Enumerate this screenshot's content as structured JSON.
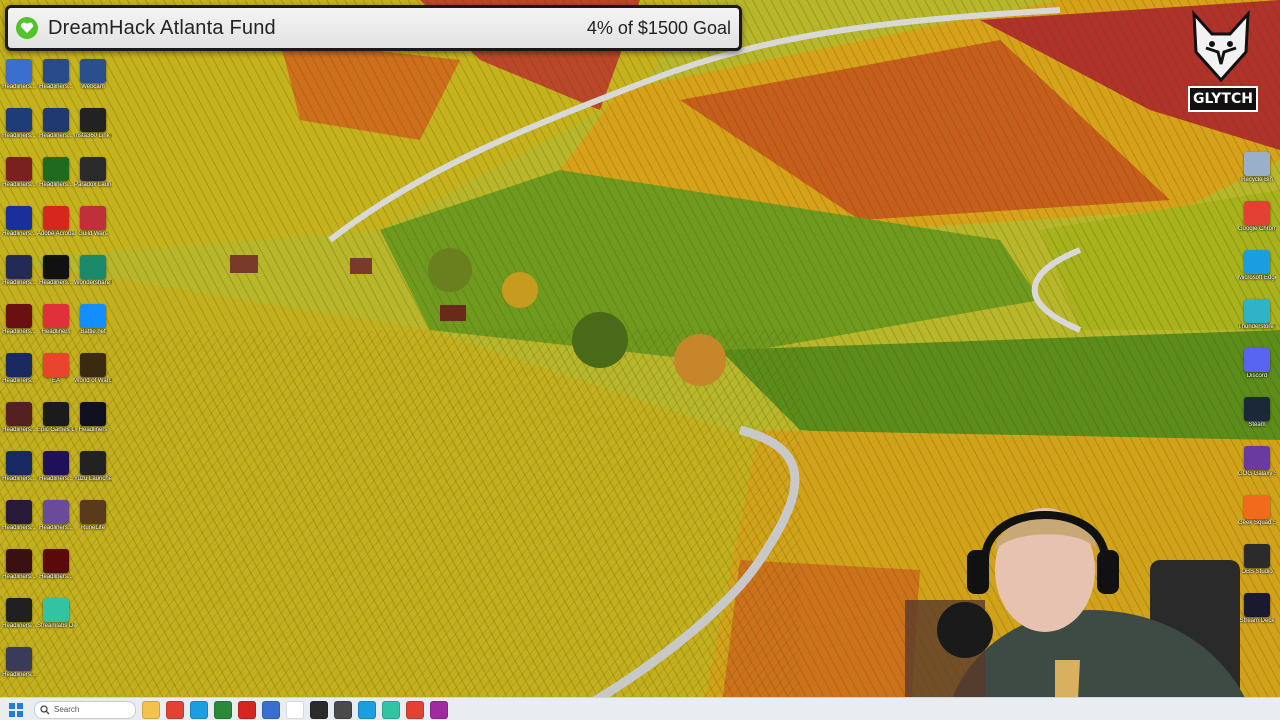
{
  "fund_banner": {
    "title": "DreamHack Atlanta Fund",
    "goal_text": "4% of $1500 Goal",
    "progress_fraction": 0.04
  },
  "streamer_logo": {
    "text": "GLYTCH"
  },
  "desktop": {
    "left_column_1": [
      {
        "label": "Headliners...",
        "icon": "app-icon",
        "color": "#3a6fcf"
      },
      {
        "label": "Headliners...",
        "icon": "app-icon",
        "color": "#1f3c7a"
      },
      {
        "label": "Headliners...",
        "icon": "app-icon",
        "color": "#7a2020"
      },
      {
        "label": "Headliners...",
        "icon": "app-icon",
        "color": "#1b2f9c"
      },
      {
        "label": "Headliners...",
        "icon": "app-icon",
        "color": "#222a55"
      },
      {
        "label": "Headliners...",
        "icon": "app-icon",
        "color": "#6a1010"
      },
      {
        "label": "Headliners...",
        "icon": "app-icon",
        "color": "#1a2a60"
      },
      {
        "label": "Headliners...",
        "icon": "app-icon",
        "color": "#552020"
      },
      {
        "label": "Headliners...",
        "icon": "app-icon",
        "color": "#182860"
      },
      {
        "label": "Headliners...",
        "icon": "app-icon",
        "color": "#2a1a3a"
      },
      {
        "label": "Headliners...",
        "icon": "app-icon",
        "color": "#3a1010"
      },
      {
        "label": "Headliners...",
        "icon": "app-icon",
        "color": "#202020"
      },
      {
        "label": "Headliners...",
        "icon": "app-icon",
        "color": "#3a3a5a"
      }
    ],
    "left_column_2": [
      {
        "label": "Headliners...",
        "icon": "app-icon",
        "color": "#284b8c"
      },
      {
        "label": "Headliners...",
        "icon": "app-icon",
        "color": "#203a70"
      },
      {
        "label": "Headliners...",
        "icon": "app-icon",
        "color": "#1e6a1e"
      },
      {
        "label": "Adobe Acrobat",
        "icon": "acrobat-icon",
        "color": "#d7261e"
      },
      {
        "label": "Headliners...",
        "icon": "app-icon",
        "color": "#111111"
      },
      {
        "label": "Headliners",
        "icon": "app-icon",
        "color": "#e0303a"
      },
      {
        "label": "EA",
        "icon": "ea-icon",
        "color": "#e8452c"
      },
      {
        "label": "Epic Games Launcher",
        "icon": "epic-games-icon",
        "color": "#1b1b1b"
      },
      {
        "label": "Headliners...",
        "icon": "app-icon",
        "color": "#20105a"
      },
      {
        "label": "Headliners...",
        "icon": "app-icon",
        "color": "#6a4a9a"
      },
      {
        "label": "Headliners...",
        "icon": "app-icon",
        "color": "#5a0a0a"
      },
      {
        "label": "Streamlabs Desktop",
        "icon": "streamlabs-icon",
        "color": "#31c3a2"
      }
    ],
    "left_column_3": [
      {
        "label": "Webcam",
        "icon": "webcam-icon",
        "color": "#2b4e8c"
      },
      {
        "label": "Insta360 Link Webcam",
        "icon": "webcam-icon",
        "color": "#222222"
      },
      {
        "label": "Paradox Launcher",
        "icon": "paradox-icon",
        "color": "#2a2a2a"
      },
      {
        "label": "Guild Wars",
        "icon": "app-icon",
        "color": "#c0303a"
      },
      {
        "label": "Wondershare Filmora",
        "icon": "filmora-icon",
        "color": "#1a8a6a"
      },
      {
        "label": "Battle.net",
        "icon": "battlenet-icon",
        "color": "#148eff"
      },
      {
        "label": "World of Warcraft",
        "icon": "wow-icon",
        "color": "#3a2a10"
      },
      {
        "label": "Headliners",
        "icon": "app-icon",
        "color": "#101020"
      },
      {
        "label": "Yuzu Launcher",
        "icon": "app-icon",
        "color": "#222222"
      },
      {
        "label": "RuneLite",
        "icon": "runelite-icon",
        "color": "#5a3a1a"
      }
    ],
    "right_column": [
      {
        "label": "Recycle Bin",
        "icon": "recycle-bin-icon",
        "color": "#9ab0c8"
      },
      {
        "label": "Google Chrome",
        "icon": "chrome-icon",
        "color": "#e34133"
      },
      {
        "label": "Microsoft Edge",
        "icon": "edge-icon",
        "color": "#1b9de2"
      },
      {
        "label": "Thunderstore Mod Manager",
        "icon": "thunderstore-icon",
        "color": "#2fb3c8"
      },
      {
        "label": "Discord",
        "icon": "discord-icon",
        "color": "#5865f2"
      },
      {
        "label": "Steam",
        "icon": "steam-icon",
        "color": "#1b2838"
      },
      {
        "label": "GOG Galaxy Shortcut",
        "icon": "gog-icon",
        "color": "#6a3aa0"
      },
      {
        "label": "Geek Squad Support.exe",
        "icon": "geek-squad-icon",
        "color": "#f26b1d"
      },
      {
        "label": "OBS Studio",
        "icon": "obs-icon",
        "color": "#2b2b2b"
      },
      {
        "label": "Stream Deck",
        "icon": "stream-deck-icon",
        "color": "#1a1a2e"
      }
    ]
  },
  "taskbar": {
    "search_placeholder": "Search",
    "apps": [
      {
        "name": "file-explorer-icon",
        "color": "#f2c14e"
      },
      {
        "name": "chrome-icon",
        "color": "#e34133"
      },
      {
        "name": "edge-icon",
        "color": "#1b9de2"
      },
      {
        "name": "app-icon",
        "color": "#2a8a3a"
      },
      {
        "name": "app-icon",
        "color": "#d7261e"
      },
      {
        "name": "app-icon",
        "color": "#3a6fcf"
      },
      {
        "name": "app-icon",
        "color": "#ffffff"
      },
      {
        "name": "app-icon",
        "color": "#2b2b2b"
      },
      {
        "name": "app-icon",
        "color": "#4a4a4a"
      },
      {
        "name": "app-icon",
        "color": "#1b9de2"
      },
      {
        "name": "app-icon",
        "color": "#31c3a2"
      },
      {
        "name": "app-icon",
        "color": "#e34133"
      },
      {
        "name": "app-icon",
        "color": "#a02aa0"
      }
    ]
  }
}
